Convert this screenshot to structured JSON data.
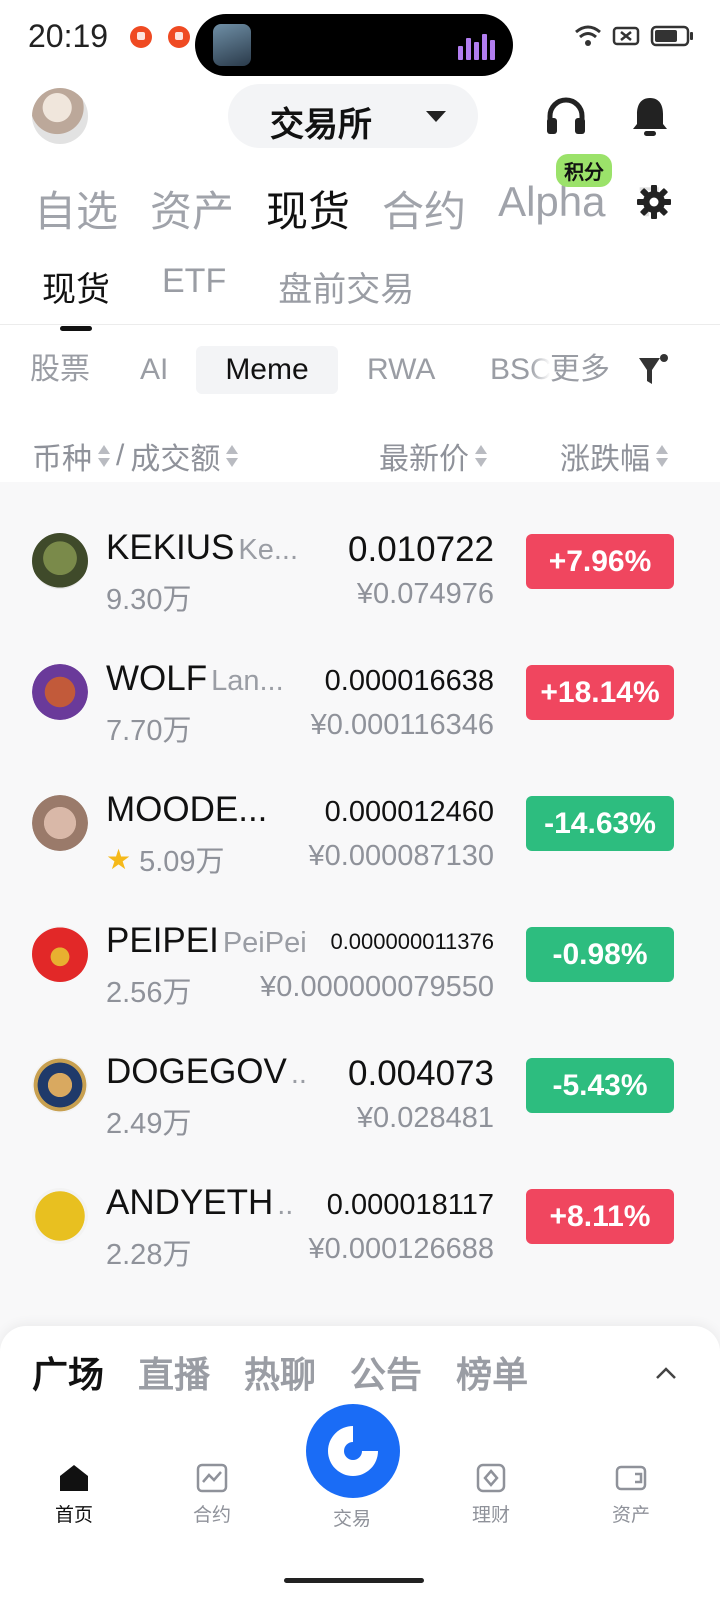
{
  "status_bar": {
    "time": "20:19"
  },
  "header": {
    "exchange_label": "交易所"
  },
  "main_tabs": [
    {
      "label": "自选"
    },
    {
      "label": "资产"
    },
    {
      "label": "现货"
    },
    {
      "label": "合约"
    },
    {
      "label": "Alpha",
      "badge": "积分"
    },
    {
      "label": "7"
    }
  ],
  "sub_tabs": [
    {
      "label": "现货"
    },
    {
      "label": "ETF"
    },
    {
      "label": "盘前交易"
    }
  ],
  "categories": [
    {
      "label": "股票"
    },
    {
      "label": "AI"
    },
    {
      "label": "Meme"
    },
    {
      "label": "RWA"
    },
    {
      "label": "BSC"
    },
    {
      "label": "更多"
    }
  ],
  "columns": {
    "coin": "币种",
    "sep": "/",
    "volume": "成交额",
    "price": "最新价",
    "change": "涨跌幅"
  },
  "rows": [
    {
      "symbol": "KEKIUS",
      "name": "Ke...",
      "volume": "9.30万",
      "price": "0.010722",
      "price_cny": "¥0.074976",
      "change": "+7.96%",
      "direction": "up"
    },
    {
      "symbol": "WOLF",
      "name": "Lan...",
      "volume": "7.70万",
      "price": "0.000016638",
      "price_cny": "¥0.000116346",
      "change": "+18.14%",
      "direction": "up"
    },
    {
      "symbol": "MOODE...",
      "name": "",
      "volume": "5.09万",
      "price": "0.000012460",
      "price_cny": "¥0.000087130",
      "change": "-14.63%",
      "direction": "down"
    },
    {
      "symbol": "PEIPEI",
      "name": "PeiPei",
      "volume": "2.56万",
      "price": "0.000000011376",
      "price_cny": "¥0.000000079550",
      "change": "-0.98%",
      "direction": "down"
    },
    {
      "symbol": "DOGEGOV",
      "name": "..",
      "volume": "2.49万",
      "price": "0.004073",
      "price_cny": "¥0.028481",
      "change": "-5.43%",
      "direction": "down"
    },
    {
      "symbol": "ANDYETH",
      "name": "..",
      "volume": "2.28万",
      "price": "0.000018117",
      "price_cny": "¥0.000126688",
      "change": "+8.11%",
      "direction": "up"
    }
  ],
  "sheet_tabs": [
    {
      "label": "广场"
    },
    {
      "label": "直播"
    },
    {
      "label": "热聊"
    },
    {
      "label": "公告"
    },
    {
      "label": "榜单"
    }
  ],
  "bottom_nav": [
    {
      "label": "首页"
    },
    {
      "label": "合约"
    },
    {
      "label": "交易"
    },
    {
      "label": "理财"
    },
    {
      "label": "资产"
    }
  ],
  "colors": {
    "up": "#f0465f",
    "down": "#2dbd7f",
    "brand_blue": "#1a6cf6",
    "alpha_badge": "#9be26a"
  }
}
